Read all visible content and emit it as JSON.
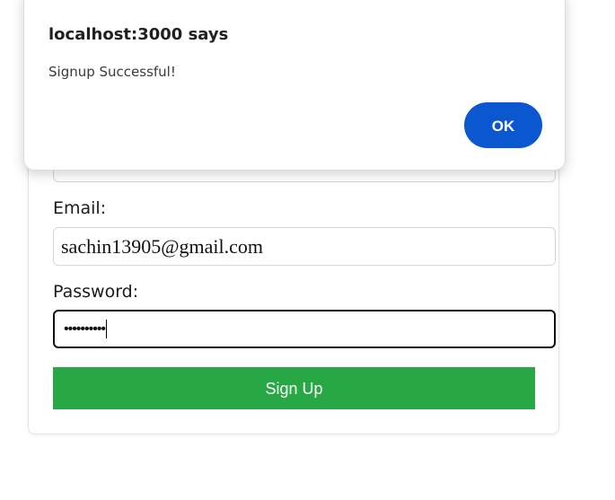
{
  "alert": {
    "title": "localhost:3000 says",
    "message": "Signup Successful!",
    "ok_label": "OK",
    "ok_color": "#0b57d0"
  },
  "form": {
    "email_label": "Email:",
    "email_value": "sachin13905@gmail.com",
    "password_label": "Password:",
    "password_value": "••••••••••",
    "submit_label": "Sign Up",
    "submit_color": "#28a745"
  }
}
